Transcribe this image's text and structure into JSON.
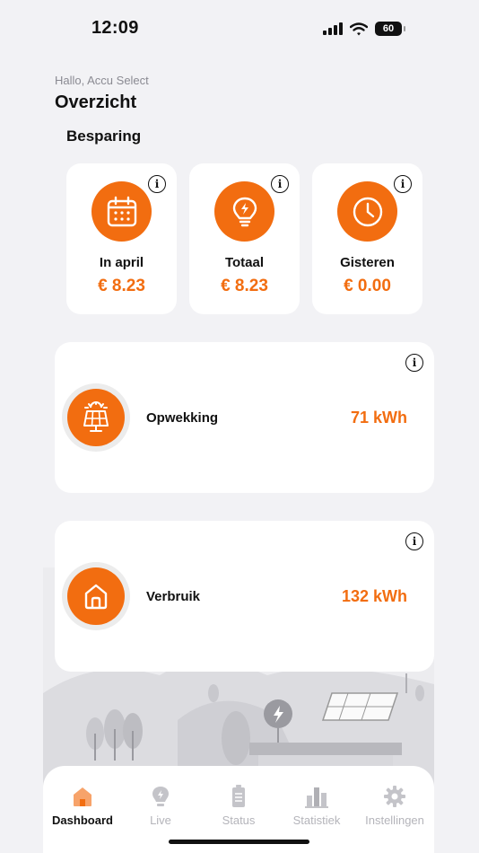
{
  "status_bar": {
    "time": "12:09",
    "battery": "60"
  },
  "header": {
    "greeting": "Hallo, Accu Select",
    "title": "Overzicht"
  },
  "besparing": {
    "section_title": "Besparing",
    "cards": [
      {
        "label": "In april",
        "value": "€ 8.23",
        "icon": "calendar-icon"
      },
      {
        "label": "Totaal",
        "value": "€ 8.23",
        "icon": "lightbulb-icon"
      },
      {
        "label": "Gisteren",
        "value": "€ 0.00",
        "icon": "clock-icon"
      }
    ]
  },
  "energy": {
    "opwekking": {
      "label": "Opwekking",
      "value": "71 kWh",
      "icon": "solar-panel-icon"
    },
    "verbruik": {
      "label": "Verbruik",
      "value": "132 kWh",
      "icon": "house-icon"
    }
  },
  "tabbar": {
    "items": [
      {
        "label": "Dashboard",
        "icon": "home-icon",
        "active": true
      },
      {
        "label": "Live",
        "icon": "bulb-icon",
        "active": false
      },
      {
        "label": "Status",
        "icon": "battery-icon",
        "active": false
      },
      {
        "label": "Statistiek",
        "icon": "bar-chart-icon",
        "active": false
      },
      {
        "label": "Instellingen",
        "icon": "gear-icon",
        "active": false
      }
    ]
  },
  "colors": {
    "accent": "#f26d10",
    "background": "#f2f2f5",
    "card": "#ffffff"
  }
}
